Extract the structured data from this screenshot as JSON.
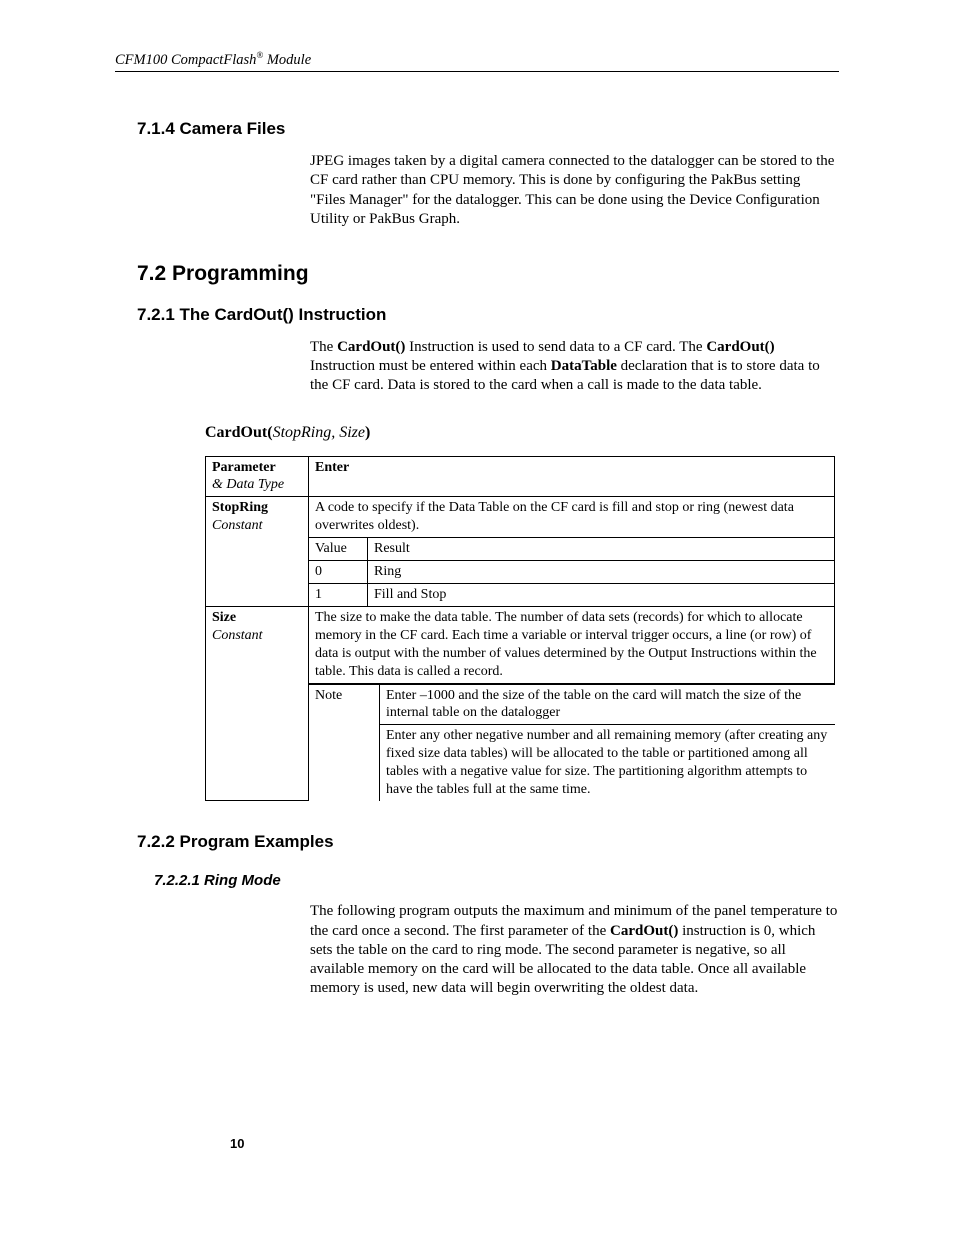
{
  "header": {
    "product": "CFM100 CompactFlash",
    "reg": "®",
    "suffix": " Module"
  },
  "sec_714": {
    "heading": "7.1.4  Camera Files",
    "para": "JPEG images taken by a digital camera connected to the datalogger can be stored to the CF card rather than CPU memory.  This is done by configuring the PakBus setting \"Files Manager\" for the datalogger.  This can be done using the Device Configuration Utility or PakBus Graph."
  },
  "sec_72": {
    "heading": "7.2  Programming"
  },
  "sec_721": {
    "heading": "7.2.1  The CardOut() Instruction",
    "para_pre": "The ",
    "b1": "CardOut()",
    "mid1": " Instruction is used to send data to a CF card.  The ",
    "b2": "CardOut()",
    "mid2": " Instruction must be entered within each ",
    "b3": "DataTable",
    "mid3": " declaration that is to store data to the CF card.  Data is stored to the card when a call is made to the data table."
  },
  "syntax": {
    "fn": "CardOut(",
    "args": "StopRing, Size",
    "close": ")"
  },
  "table": {
    "h_param": "Parameter",
    "h_datatype": "& Data Type",
    "h_enter": "Enter",
    "stopring": {
      "name": "StopRing",
      "type": "Constant",
      "desc": "A code to specify if the Data Table on the CF card is fill and stop or ring (newest data overwrites oldest).",
      "col_value": "Value",
      "col_result": "Result",
      "r0_v": "0",
      "r0_r": "Ring",
      "r1_v": "1",
      "r1_r": "Fill and Stop"
    },
    "size": {
      "name": "Size",
      "type": "Constant",
      "desc": "The size to make the data table.  The number of data sets (records) for which to allocate memory in the CF card.  Each time a variable or interval trigger occurs, a line (or row) of data is output with the number of values determined by the Output Instructions within the table.  This data is called a record.",
      "note_lbl": "Note",
      "note1": "Enter –1000 and  the size of the table on the card will match the size of the internal table on the datalogger",
      "note2": "Enter any other  negative number and all remaining memory (after creating any fixed size data tables) will be allocated to the table or partitioned among all tables with a negative value for size.  The partitioning algorithm attempts to have the tables full at the same time."
    }
  },
  "sec_722": {
    "heading": "7.2.2  Program Examples"
  },
  "sec_7221": {
    "heading": "7.2.2.1  Ring Mode",
    "para_pre": "The following program outputs the maximum and minimum of the panel temperature to the card once a second.  The first parameter of the ",
    "b1": "CardOut()",
    "para_post": " instruction is 0, which sets the table on the card to ring mode. The second parameter is negative, so all available memory on the card will be allocated to the data table.  Once all available memory is used, new data will begin overwriting the oldest data."
  },
  "page_number": "10"
}
